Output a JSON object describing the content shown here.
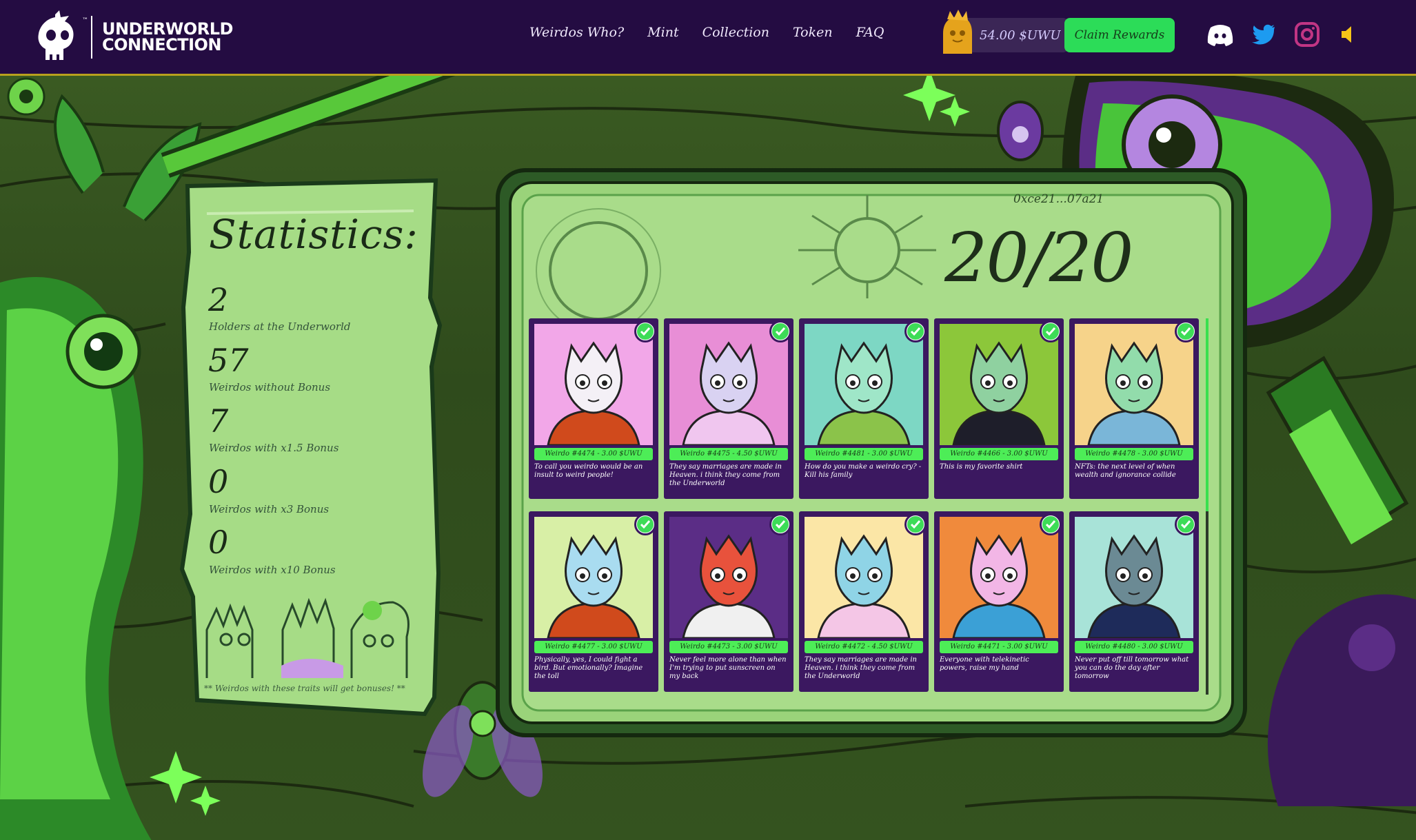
{
  "header": {
    "logo": {
      "line1": "UNDERWORLD",
      "line2": "CONNECTION",
      "tm": "™"
    },
    "nav": [
      "Weirdos Who?",
      "Mint",
      "Collection",
      "Token",
      "FAQ"
    ],
    "balance": "54.00 $UWU",
    "claim_label": "Claim Rewards",
    "socials": [
      "discord-icon",
      "twitter-icon",
      "instagram-icon",
      "sound-icon"
    ],
    "colors": {
      "bg": "#240c42",
      "claim": "#2cdc58",
      "twitter": "#1d9bf0",
      "instagram": "#c13584",
      "sound": "#f5c518"
    }
  },
  "statistics": {
    "title": "Statistics:",
    "items": [
      {
        "value": "2",
        "label": "Holders at the Underworld"
      },
      {
        "value": "57",
        "label": "Weirdos without Bonus"
      },
      {
        "value": "7",
        "label": "Weirdos with x1.5 Bonus"
      },
      {
        "value": "0",
        "label": "Weirdos with x3 Bonus"
      },
      {
        "value": "0",
        "label": "Weirdos with x10 Bonus"
      }
    ],
    "note": "** Weirdos with these traits will get bonuses! **"
  },
  "collection": {
    "wallet_short": "0xce21...07a21",
    "count": "20/20",
    "cards": [
      {
        "tag": "Weirdo #4474 - 3.00 $UWU",
        "quote": "To call you weirdo would be an insult to weird people!",
        "bg": "#f2a7e8",
        "skin": "#f4f0f6",
        "shirt": "#d04a1c"
      },
      {
        "tag": "Weirdo #4475 - 4.50 $UWU",
        "quote": "They say marriages are made in Heaven. i think they come from the Underworld",
        "bg": "#e88ed6",
        "skin": "#d9d2f2",
        "shirt": "#f0c6ef"
      },
      {
        "tag": "Weirdo #4481 - 3.00 $UWU",
        "quote": "How do you make a weirdo cry? - Kill his family",
        "bg": "#7dd7c4",
        "skin": "#9fe6c8",
        "shirt": "#8bc34a"
      },
      {
        "tag": "Weirdo #4466 - 3.00 $UWU",
        "quote": "This is my favorite shirt",
        "bg": "#8cc73a",
        "skin": "#8fd1a0",
        "shirt": "#1e1e2a"
      },
      {
        "tag": "Weirdo #4478 - 3.00 $UWU",
        "quote": "NFTs: the next level of when wealth and ignorance collide",
        "bg": "#f6d38a",
        "skin": "#92dcab",
        "shirt": "#7ab6d8"
      },
      {
        "tag": "Weirdo #4477 - 3.00 $UWU",
        "quote": "Physically, yes, I could fight a bird. But emotionally? Imagine the toll",
        "bg": "#d8efa6",
        "skin": "#a9dcf0",
        "shirt": "#d04a1c"
      },
      {
        "tag": "Weirdo #4473 - 3.00 $UWU",
        "quote": "Never feel more alone than when I'm trying to put sunscreen on my back",
        "bg": "#5b2d86",
        "skin": "#e8523c",
        "shirt": "#f0f0f0"
      },
      {
        "tag": "Weirdo #4472 - 4.50 $UWU",
        "quote": "They say marriages are made in Heaven. i think they come from the Underworld",
        "bg": "#fbe6a6",
        "skin": "#8fd4e6",
        "shirt": "#f4c6e6"
      },
      {
        "tag": "Weirdo #4471 - 3.00 $UWU",
        "quote": "Everyone with telekinetic powers, raise my hand",
        "bg": "#f08a3c",
        "skin": "#f2b6e6",
        "shirt": "#3ba0d6"
      },
      {
        "tag": "Weirdo #4480 - 3.00 $UWU",
        "quote": "Never put off till tomorrow what you can do the day after tomorrow",
        "bg": "#a8e3d8",
        "skin": "#6b8a94",
        "shirt": "#1e2b5a"
      }
    ]
  }
}
